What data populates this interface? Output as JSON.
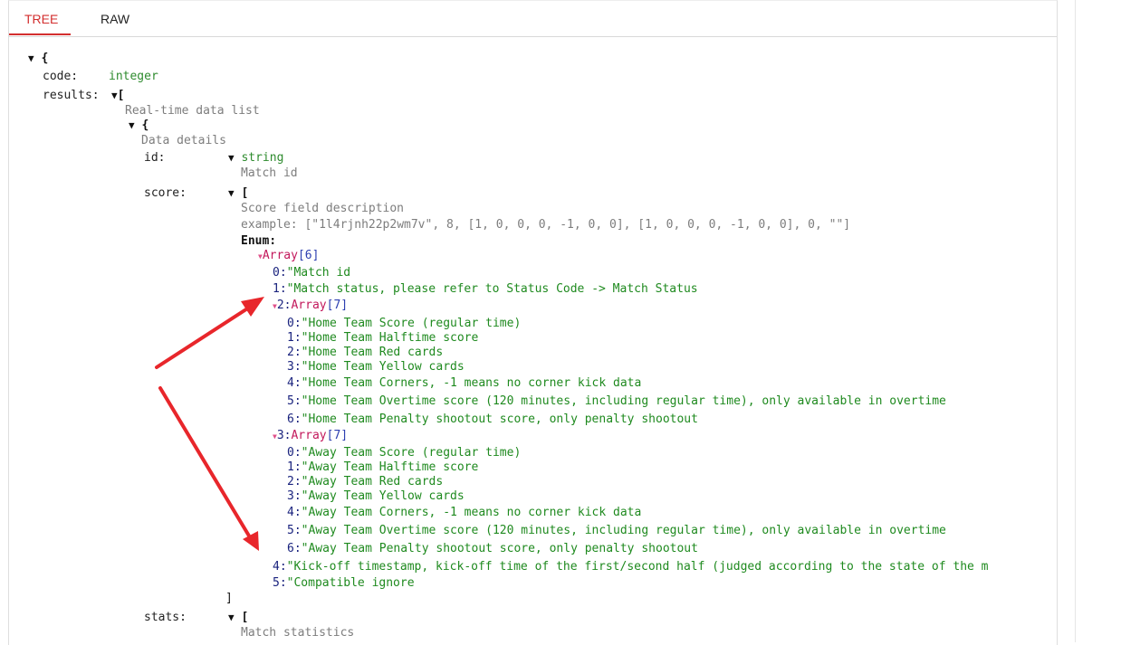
{
  "tabs": [
    {
      "label": "TREE",
      "active": true
    },
    {
      "label": "RAW",
      "active": false
    }
  ],
  "tree": {
    "root_open": "{",
    "code_key": "code:",
    "code_type": "integer",
    "results_key": "results:",
    "results_open": "[",
    "results_desc": "Real-time data list",
    "item_open": "{",
    "item_desc": "Data details",
    "id_key": "id:",
    "id_type": "string",
    "id_desc": "Match id",
    "score_key": "score:",
    "score_open": "[",
    "score_desc": "Score field description",
    "example_label": "example:",
    "example_value": "[\"1l4rjnh22p2wm7v\", 8, [1, 0, 0, 0, -1, 0, 0], [1, 0, 0, 0, -1, 0, 0], 0, \"\"]",
    "enum_label": "Enum:",
    "enum_array": {
      "name": "Array",
      "count": "[6]"
    },
    "enum_items": [
      {
        "idx": "0:",
        "text": "\"Match id"
      },
      {
        "idx": "1:",
        "text": "\"Match status, please refer to Status Code -> Match Status"
      },
      {
        "idx": "2:",
        "array": "Array",
        "count": "[7]"
      },
      {
        "idx": "3:",
        "array": "Array",
        "count": "[7]"
      },
      {
        "idx": "4:",
        "text": "\"Kick-off timestamp, kick-off time of the first/second half (judged according to the state of the m"
      },
      {
        "idx": "5:",
        "text": "\"Compatible ignore"
      }
    ],
    "home_items": [
      {
        "idx": "0:",
        "text": "\"Home Team Score (regular time)"
      },
      {
        "idx": "1:",
        "text": "\"Home Team Halftime score"
      },
      {
        "idx": "2:",
        "text": "\"Home Team Red cards"
      },
      {
        "idx": "3:",
        "text": "\"Home Team Yellow cards"
      },
      {
        "idx": "4:",
        "text": "\"Home Team Corners, -1 means no corner kick data"
      },
      {
        "idx": "5:",
        "text": "\"Home Team Overtime score (120 minutes, including regular time), only available in overtime"
      },
      {
        "idx": "6:",
        "text": "\"Home Team Penalty shootout score, only penalty shootout"
      }
    ],
    "away_items": [
      {
        "idx": "0:",
        "text": "\"Away Team Score (regular time)"
      },
      {
        "idx": "1:",
        "text": "\"Away Team Halftime score"
      },
      {
        "idx": "2:",
        "text": "\"Away Team Red cards"
      },
      {
        "idx": "3:",
        "text": "\"Away Team Yellow cards"
      },
      {
        "idx": "4:",
        "text": "\"Away Team Corners, -1 means no corner kick data"
      },
      {
        "idx": "5:",
        "text": "\"Away Team Overtime score (120 minutes, including regular time), only available in overtime"
      },
      {
        "idx": "6:",
        "text": "\"Away Team Penalty shootout score, only penalty shootout"
      }
    ],
    "score_close": "]",
    "stats_key": "stats:",
    "stats_open": "[",
    "stats_desc": "Match statistics"
  },
  "icons": {
    "toggle": "caret-down-icon",
    "array_toggle": "small-caret-down-icon",
    "annotation": "red-arrow-icon"
  },
  "colors": {
    "active_tab": "#d32f2f",
    "type": "#2e8b2e",
    "string": "#1f8a1f",
    "array": "#c2185b",
    "count": "#2d3fb0",
    "annotation_arrow": "#e8262b"
  }
}
